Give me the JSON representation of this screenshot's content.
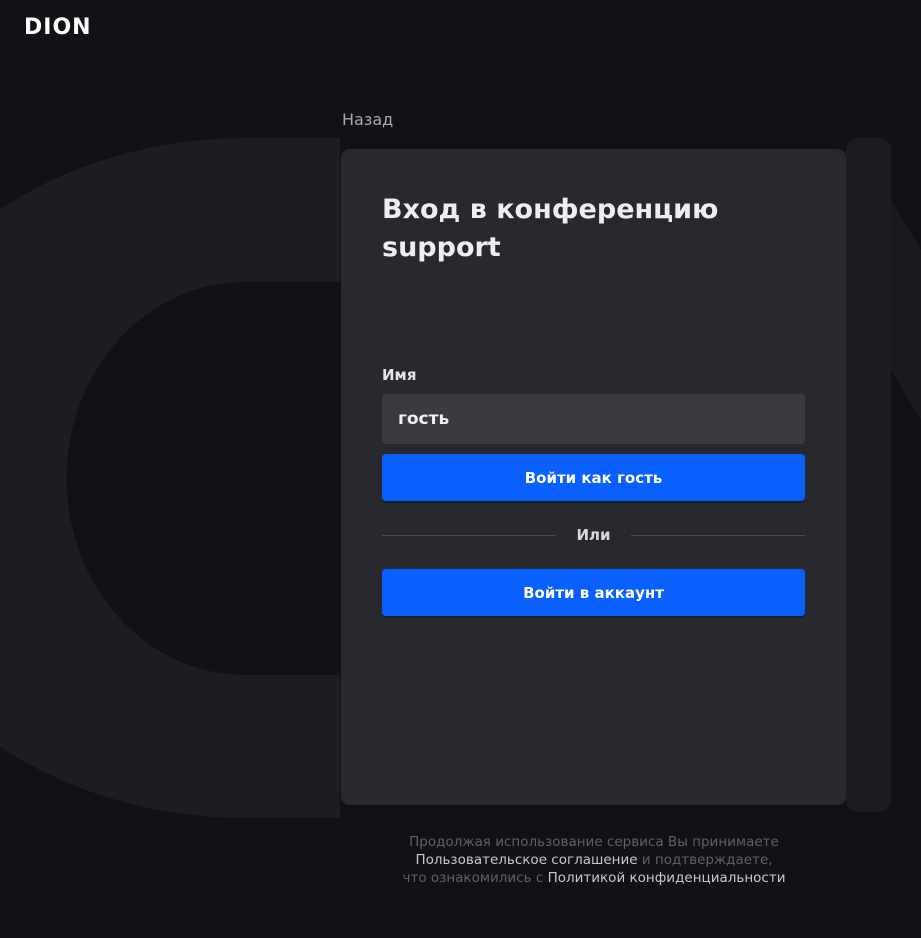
{
  "brand": {
    "logo_text": "DION"
  },
  "nav": {
    "back_label": "Назад"
  },
  "login": {
    "title": "Вход в конференцию support",
    "name_label": "Имя",
    "name_value": "гость",
    "guest_button_label": "Войти как гость",
    "divider_label": "Или",
    "account_button_label": "Войти в аккаунт"
  },
  "footer": {
    "text_1": "Продолжая использование сервиса Вы принимаете",
    "user_agreement_link": "Пользовательское соглашение",
    "text_2": " и подтверждаете,",
    "text_3": "что ознакомились с ",
    "privacy_policy_link": "Политикой конфиденциальности"
  },
  "colors": {
    "background": "#111215",
    "card": "#28292e",
    "input": "#3a3b41",
    "accent": "#0a5fff",
    "muted_text": "#a7a8ad"
  }
}
